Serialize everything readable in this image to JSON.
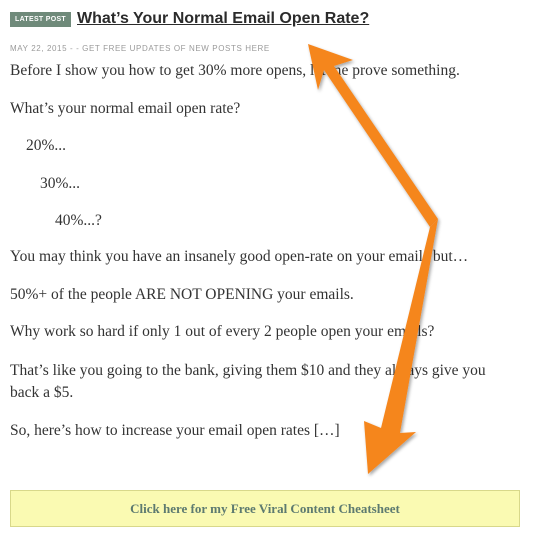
{
  "post": {
    "badge": "LATEST POST",
    "title": "What’s Your Normal Email Open Rate?",
    "meta": "MAY 22, 2015 - - GET FREE UPDATES OF NEW POSTS HERE",
    "paragraphs": {
      "p1": "Before I show you how to get 30% more opens, let me prove something.",
      "p2": "What’s your normal email open rate?",
      "p3": "20%...",
      "p4": "30%...",
      "p5": "40%...?",
      "p6": "You may think you have an insanely good open-rate on your emails but…",
      "p7": "50%+ of the people ARE NOT OPENING your emails.",
      "p8": "Why work so hard if only 1 out of every 2 people open your emails?",
      "p9": "That’s like you going to the bank, giving them $10 and they always give you back a $5.",
      "p10": "So, here’s how to increase your email open rates […]"
    }
  },
  "cta": {
    "label": "Click here for my Free Viral Content Cheatsheet"
  },
  "annotations": {
    "arrow_color": "#f5861f"
  }
}
